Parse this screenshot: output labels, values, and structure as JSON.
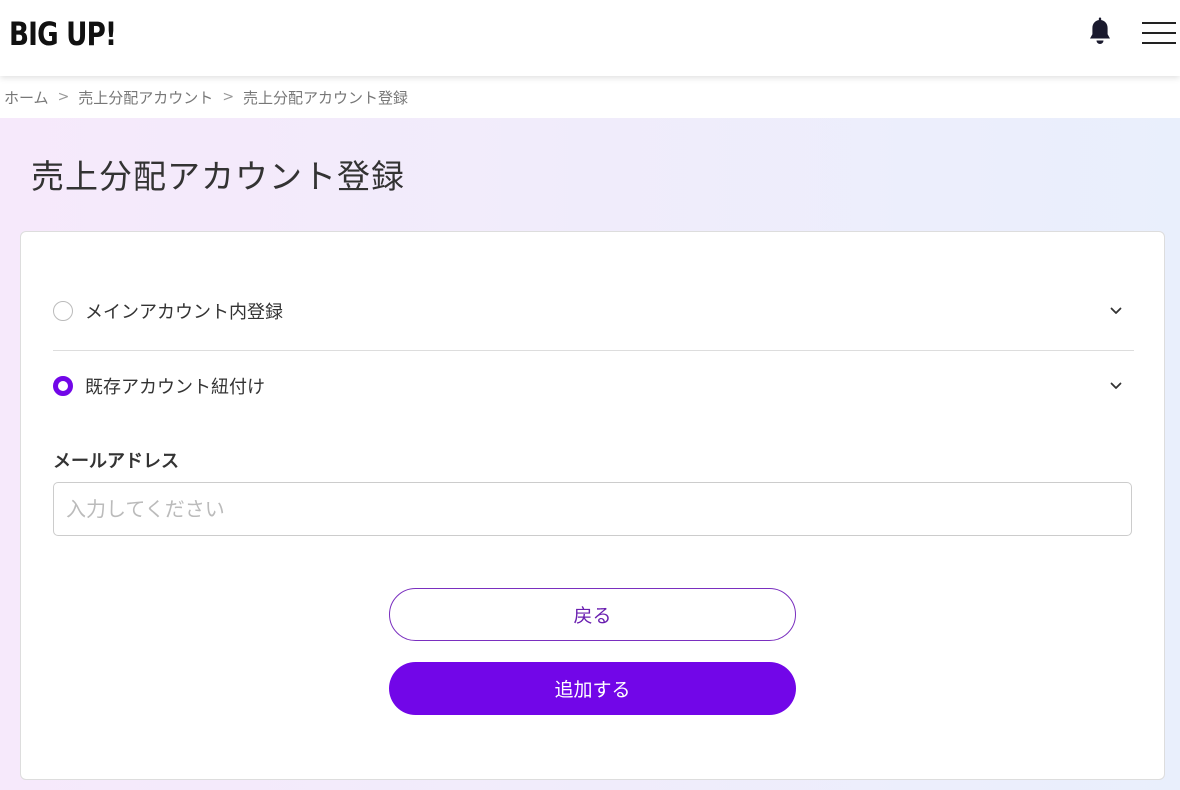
{
  "header": {
    "logo": "BIG UP!",
    "bell_icon": "bell-icon",
    "menu_icon": "hamburger-menu-icon"
  },
  "breadcrumb": {
    "items": [
      "ホーム",
      "売上分配アカウント",
      "売上分配アカウント登録"
    ],
    "separator_icon": "chevron-right-icon"
  },
  "page": {
    "title": "売上分配アカウント登録"
  },
  "form": {
    "options": [
      {
        "label": "メインアカウント内登録",
        "selected": false
      },
      {
        "label": "既存アカウント紐付け",
        "selected": true
      }
    ],
    "email": {
      "label": "メールアドレス",
      "value": "",
      "placeholder": "入力してください"
    },
    "back_label": "戻る",
    "add_label": "追加する"
  },
  "colors": {
    "accent": "#7206e8",
    "back_border": "#7a2fbf"
  }
}
